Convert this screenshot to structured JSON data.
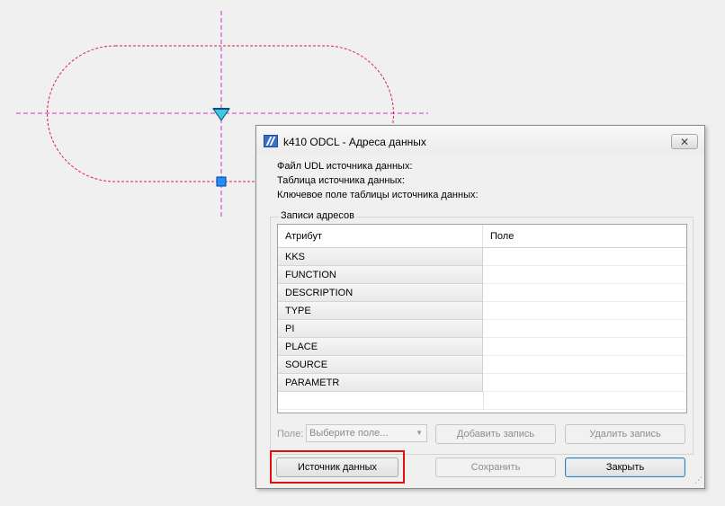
{
  "dialog": {
    "title": "k410 ODCL - Адреса данных",
    "close_icon": "close-icon",
    "info": {
      "udl_file": "Файл UDL источника данных:",
      "source_table": "Таблица источника данных:",
      "key_field": "Ключевое поле таблицы источника данных:"
    },
    "group_label": "Записи адресов",
    "grid": {
      "columns": [
        "Атрибут",
        "Поле"
      ],
      "rows": [
        {
          "attribute": "KKS",
          "field": ""
        },
        {
          "attribute": "FUNCTION",
          "field": ""
        },
        {
          "attribute": "DESCRIPTION",
          "field": ""
        },
        {
          "attribute": "TYPE",
          "field": ""
        },
        {
          "attribute": "PI",
          "field": ""
        },
        {
          "attribute": "PLACE",
          "field": ""
        },
        {
          "attribute": "SOURCE",
          "field": ""
        },
        {
          "attribute": "PARAMETR",
          "field": ""
        }
      ]
    },
    "field_label": "Поле:",
    "field_select": {
      "selected": "Выберите поле..."
    },
    "buttons": {
      "add": "Добавить запись",
      "delete": "Удалить запись",
      "data_source": "Источник данных",
      "save": "Сохранить",
      "close": "Закрыть"
    }
  },
  "colors": {
    "construction_line": "#cc33cc",
    "outline_dash": "#e0243c",
    "grip_fill": "#1e90ff",
    "triangle_fill": "#3ec8e0",
    "highlight": "#e01010"
  }
}
